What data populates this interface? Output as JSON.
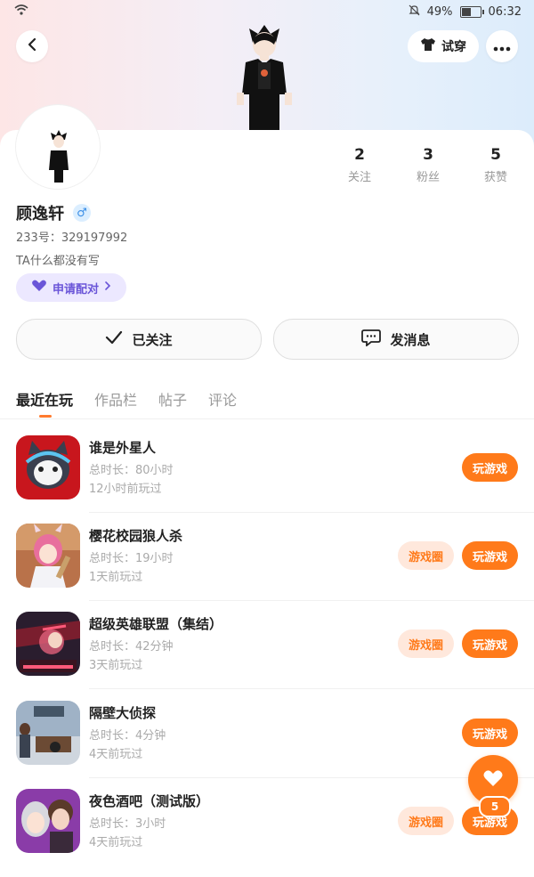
{
  "status_bar": {
    "battery": "49%",
    "time": "06:32"
  },
  "header": {
    "try_on_label": "试穿"
  },
  "profile": {
    "stats": [
      {
        "value": "2",
        "label": "关注"
      },
      {
        "value": "3",
        "label": "粉丝"
      },
      {
        "value": "5",
        "label": "获赞"
      }
    ],
    "name": "顾逸轩",
    "gender_symbol": "♂",
    "id_text": "233号：329197992",
    "bio": "TA什么都没有写",
    "pair_label": "申请配对",
    "following_label": "已关注",
    "message_label": "发消息"
  },
  "tabs": [
    {
      "label": "最近在玩",
      "active": true
    },
    {
      "label": "作品栏",
      "active": false
    },
    {
      "label": "帖子",
      "active": false
    },
    {
      "label": "评论",
      "active": false
    }
  ],
  "games": [
    {
      "name": "谁是外星人",
      "duration": "总时长：80小时",
      "last_played": "12小时前玩过",
      "play_label": "玩游戏",
      "circle_label": ""
    },
    {
      "name": "樱花校园狼人杀",
      "duration": "总时长：19小时",
      "last_played": "1天前玩过",
      "play_label": "玩游戏",
      "circle_label": "游戏圈"
    },
    {
      "name": "超级英雄联盟（集结）",
      "duration": "总时长：42分钟",
      "last_played": "3天前玩过",
      "play_label": "玩游戏",
      "circle_label": "游戏圈"
    },
    {
      "name": "隔壁大侦探",
      "duration": "总时长：4分钟",
      "last_played": "4天前玩过",
      "play_label": "玩游戏",
      "circle_label": ""
    },
    {
      "name": "夜色酒吧（测试版）",
      "duration": "总时长：3小时",
      "last_played": "4天前玩过",
      "play_label": "玩游戏",
      "circle_label": "游戏圈"
    }
  ],
  "fab": {
    "count": "5"
  },
  "colors": {
    "accent": "#ff7a1a",
    "pair_purple": "#6a55d8"
  }
}
